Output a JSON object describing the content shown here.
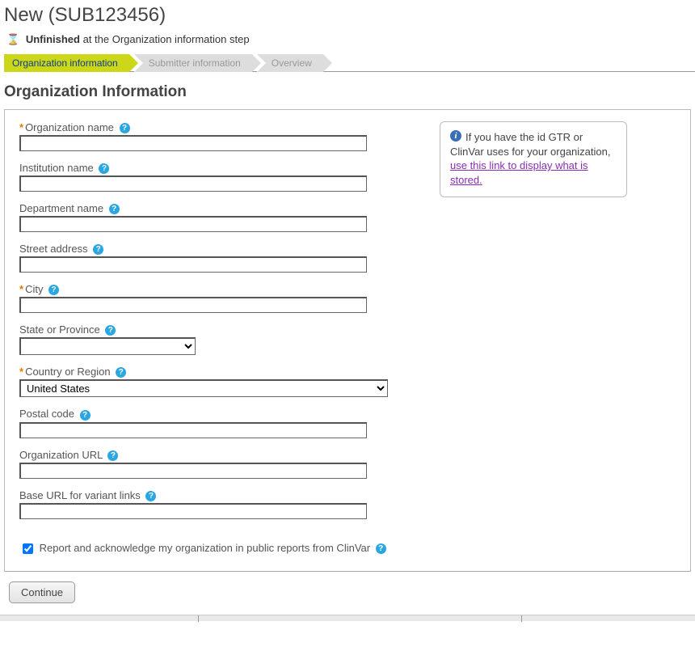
{
  "header": {
    "title": "New (SUB123456)",
    "status_prefix_bold": "Unfinished",
    "status_suffix": " at the Organization information step"
  },
  "wizard": {
    "step1": "Organization information",
    "step2": "Submitter information",
    "step3": "Overview"
  },
  "section_title": "Organization Information",
  "labels": {
    "org_name": "Organization name",
    "institution": "Institution name",
    "department": "Department name",
    "street": "Street address",
    "city": "City",
    "state": "State or Province",
    "country": "Country or Region",
    "postal": "Postal code",
    "org_url": "Organization URL",
    "base_url": "Base URL for variant links"
  },
  "values": {
    "org_name": "",
    "institution": "",
    "department": "",
    "street": "",
    "city": "",
    "state": "",
    "country": "United States",
    "postal": "",
    "org_url": "",
    "base_url": ""
  },
  "checkbox_label": "Report and acknowledge my organization in public reports from ClinVar",
  "info": {
    "text_before": "If you have the id GTR or ClinVar uses for your organization, ",
    "link": "use this link to display what is stored."
  },
  "continue_label": "Continue"
}
